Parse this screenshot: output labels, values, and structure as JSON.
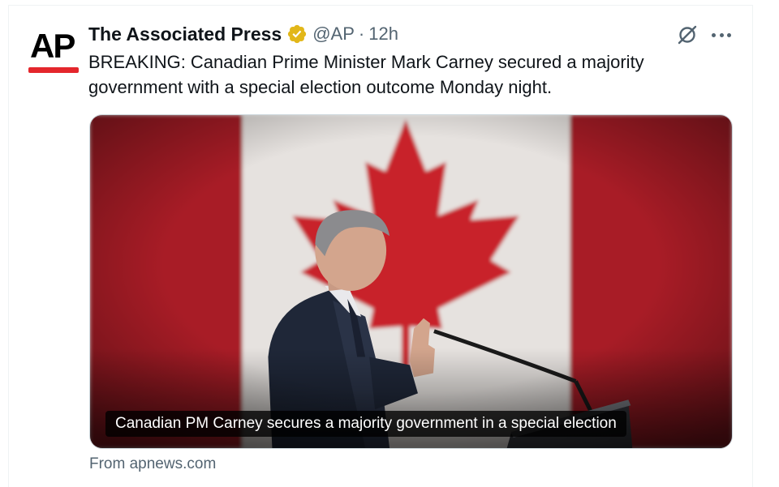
{
  "tweet": {
    "avatar": {
      "text": "AP",
      "accent_color": "#e4262c"
    },
    "author": {
      "display_name": "The Associated Press",
      "verified_icon": "gold-checkmark-badge",
      "verified_color": "#e2b719",
      "handle": "@AP",
      "separator": "·",
      "timestamp": "12h"
    },
    "header_icons": {
      "grok": "grok-slash-circle-icon",
      "more": "more-dots-icon"
    },
    "text": "BREAKING: Canadian Prime Minister Mark Carney secured a majority government with a special election outcome Monday night.",
    "media": {
      "caption": "Canadian PM Carney secures a majority government in a special election",
      "colors": {
        "flag_red": "#b1202a",
        "flag_white": "#e6e2df"
      }
    },
    "source": "From apnews.com"
  }
}
